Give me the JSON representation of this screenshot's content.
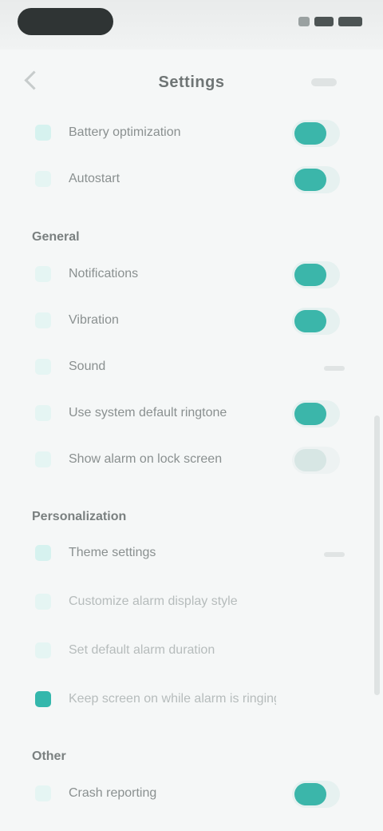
{
  "header": {
    "title": "Settings"
  },
  "sections": [
    {
      "title": "",
      "items": [
        {
          "label": "Battery optimization",
          "toggle": true
        },
        {
          "label": "Autostart",
          "toggle": true
        }
      ]
    },
    {
      "title": "General",
      "items": [
        {
          "label": "Notifications",
          "toggle": true
        },
        {
          "label": "Vibration",
          "toggle": true
        },
        {
          "label": "Sound",
          "toggle": false
        },
        {
          "label": "Use system default ringtone",
          "toggle": true
        },
        {
          "label": "Show alarm on lock screen",
          "toggle": false
        }
      ]
    },
    {
      "title": "Personalization",
      "items": [
        {
          "label": "Theme settings"
        },
        {
          "label": "Customize alarm display style"
        },
        {
          "label": "Set default alarm duration"
        },
        {
          "label": "Keep screen on while alarm is ringing"
        }
      ]
    },
    {
      "title": "Other",
      "items": [
        {
          "label": "Crash reporting",
          "toggle": true
        }
      ]
    }
  ],
  "colors": {
    "accent": "#3bb6aa",
    "accent_light": "#d6f2ef",
    "background": "#f5f7f7"
  }
}
